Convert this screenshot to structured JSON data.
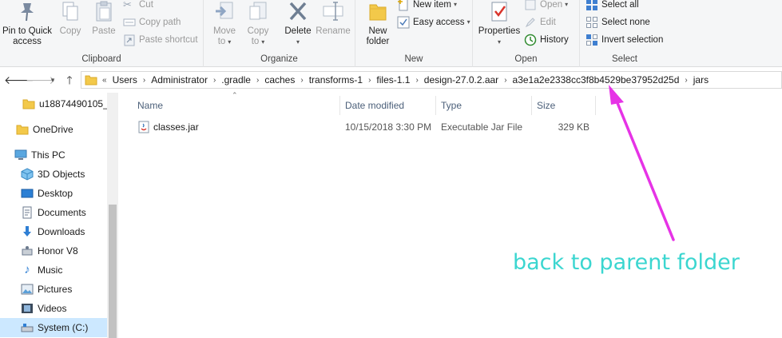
{
  "ribbon": {
    "clipboard": {
      "label": "Clipboard",
      "pin_label_1": "Pin to Quick",
      "pin_label_2": "access",
      "copy_label": "Copy",
      "paste_label": "Paste",
      "cut_label": "Cut",
      "copy_path_label": "Copy path",
      "paste_shortcut_label": "Paste shortcut"
    },
    "organize": {
      "label": "Organize",
      "move_to_1": "Move",
      "move_to_2": "to",
      "copy_to_1": "Copy",
      "copy_to_2": "to",
      "delete_label": "Delete",
      "rename_label": "Rename"
    },
    "new": {
      "label": "New",
      "new_folder_1": "New",
      "new_folder_2": "folder",
      "new_item_label": "New item",
      "easy_access_label": "Easy access"
    },
    "open": {
      "label": "Open",
      "properties_label": "Properties",
      "open_label": "Open",
      "edit_label": "Edit",
      "history_label": "History"
    },
    "select": {
      "label": "Select",
      "select_all_label": "Select all",
      "select_none_label": "Select none",
      "invert_selection_label": "Invert selection"
    }
  },
  "address": {
    "overflow": "«",
    "crumbs": [
      "Users",
      "Administrator",
      ".gradle",
      "caches",
      "transforms-1",
      "files-1.1",
      "design-27.0.2.aar",
      "a3e1a2e2338cc3f8b4529be37952d25d",
      "jars"
    ]
  },
  "sidebar": {
    "items": [
      {
        "label": "u18874490105_u"
      },
      {
        "label": "OneDrive"
      },
      {
        "label": "This PC"
      },
      {
        "label": "3D Objects"
      },
      {
        "label": "Desktop"
      },
      {
        "label": "Documents"
      },
      {
        "label": "Downloads"
      },
      {
        "label": "Honor V8"
      },
      {
        "label": "Music"
      },
      {
        "label": "Pictures"
      },
      {
        "label": "Videos"
      },
      {
        "label": "System (C:)"
      }
    ]
  },
  "columns": {
    "name": "Name",
    "date_modified": "Date modified",
    "type": "Type",
    "size": "Size"
  },
  "files": [
    {
      "name": "classes.jar",
      "date_modified": "10/15/2018 3:30 PM",
      "type": "Executable Jar File",
      "size": "329 KB"
    }
  ],
  "annotation": {
    "text": "back to parent folder",
    "color": "#3bd6d0",
    "arrow_color": "#e633e6"
  }
}
